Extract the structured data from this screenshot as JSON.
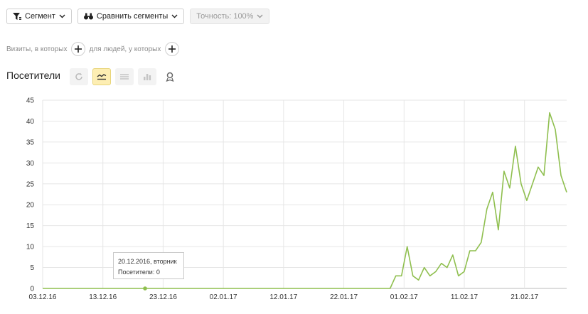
{
  "toolbar": {
    "segment_label": "Сегмент",
    "compare_label": "Сравнить сегменты",
    "accuracy_label": "Точность: 100%"
  },
  "filters": {
    "visits_text": "Визиты, в которых",
    "people_text": "для людей, у которых"
  },
  "section": {
    "title": "Посетители"
  },
  "view_buttons": [
    "refresh-icon",
    "line-chart-icon",
    "stacked-chart-icon",
    "table-chart-icon",
    "map-pin-icon"
  ],
  "tooltip": {
    "date": "20.12.2016, вторник",
    "metric": "Посетители: 0"
  },
  "colors": {
    "line": "#8fbf4f",
    "grid": "#e6e6e6",
    "accent": "#fdeeb3"
  },
  "chart_data": {
    "type": "line",
    "ylim": [
      0,
      45
    ],
    "yticks": [
      0,
      5,
      10,
      15,
      20,
      25,
      30,
      35,
      40,
      45
    ],
    "xticks": [
      "03.12.16",
      "13.12.16",
      "23.12.16",
      "02.01.17",
      "12.01.17",
      "22.01.17",
      "01.02.17",
      "11.02.17",
      "21.02.17"
    ],
    "x_start": "03.12.16",
    "x_end": "28.02.17",
    "grid": true,
    "highlight_date": "20.12.16",
    "series": [
      {
        "values": [
          0,
          0,
          0,
          0,
          0,
          0,
          0,
          0,
          0,
          0,
          0,
          0,
          0,
          0,
          0,
          0,
          0,
          0,
          0,
          0,
          0,
          0,
          0,
          0,
          0,
          0,
          0,
          0,
          0,
          0,
          0,
          0,
          0,
          0,
          0,
          0,
          0,
          0,
          0,
          0,
          0,
          0,
          0,
          0,
          0,
          0,
          0,
          0,
          0,
          0,
          0,
          0,
          0,
          0,
          0,
          0,
          0,
          0,
          0,
          0,
          0,
          0,
          3,
          3,
          10,
          3,
          2,
          5,
          3,
          4,
          6,
          5,
          8,
          3,
          4,
          9,
          9,
          11,
          19,
          23,
          14,
          28,
          24,
          34,
          25,
          21,
          25,
          29,
          27,
          42,
          38,
          27,
          23
        ]
      }
    ]
  }
}
